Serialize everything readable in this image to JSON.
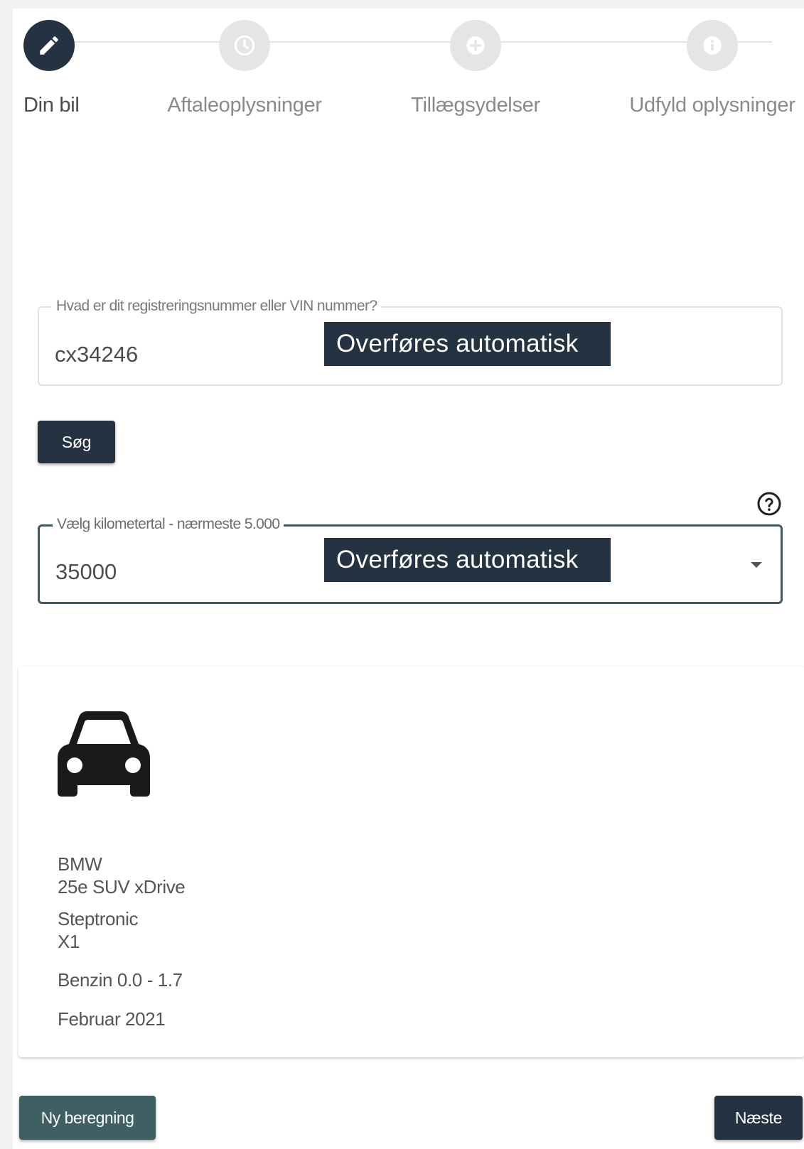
{
  "stepper": {
    "steps": [
      {
        "label": "Din bil",
        "icon": "pencil-icon",
        "state": "active"
      },
      {
        "label": "Aftaleoplysninger",
        "icon": "clock-icon",
        "state": "inactive"
      },
      {
        "label": "Tillægsydelser",
        "icon": "plus-icon",
        "state": "inactive"
      },
      {
        "label": "Udfyld oplysninger",
        "icon": "info-icon",
        "state": "inactive"
      }
    ]
  },
  "registration": {
    "label": "Hvad er dit registreringsnummer eller VIN nummer?",
    "value": "cx34246",
    "overlay": "Overføres automatisk"
  },
  "search_button": {
    "label": "Søg"
  },
  "mileage": {
    "label": "Vælg kilometertal - nærmeste 5.000",
    "value": "35000",
    "overlay": "Overføres automatisk"
  },
  "car": {
    "make": "BMW",
    "model": "25e SUV xDrive",
    "transmission": "Steptronic",
    "series": "X1",
    "fuel": "Benzin 0.0 - 1.7",
    "date": "Februar 2021"
  },
  "footer": {
    "new_calc_label": "Ny beregning",
    "next_label": "Næste"
  },
  "colors": {
    "dark_navy": "#243241",
    "teal": "#3f6062",
    "inactive_step": "#e5e5e5"
  }
}
